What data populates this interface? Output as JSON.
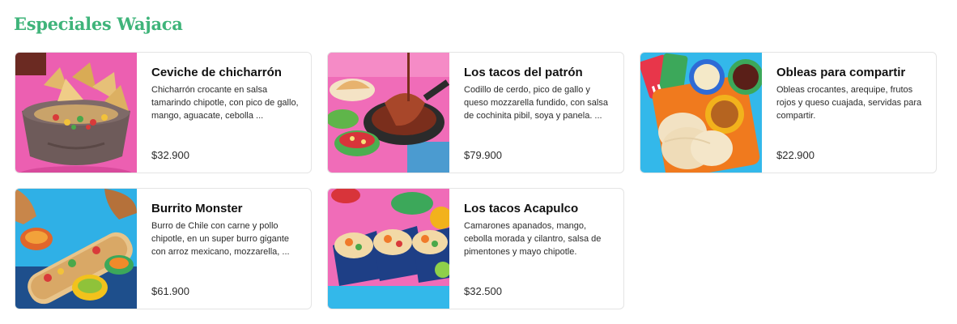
{
  "section": {
    "title": "Especiales Wajaca"
  },
  "items": [
    {
      "name": "Ceviche de chicharrón",
      "description": "Chicharrón crocante en salsa tamarindo chipotle, con pico de gallo, mango, aguacate, cebolla ...",
      "price": "$32.900",
      "image_icon": "ceviche-bowl-icon"
    },
    {
      "name": "Los tacos del patrón",
      "description": "Codillo de cerdo, pico de gallo y queso mozzarella fundido, con salsa de cochinita pibil, soya y panela. ...",
      "price": "$79.900",
      "image_icon": "tacos-skillet-icon"
    },
    {
      "name": "Obleas para compartir",
      "description": "Obleas crocantes, arequipe, frutos rojos y queso cuajada, servidas para compartir.",
      "price": "$22.900",
      "image_icon": "obleas-tray-icon"
    },
    {
      "name": "Burrito Monster",
      "description": "Burro de Chile con carne y pollo chipotle, en un super burro gigante con arroz mexicano, mozzarella, ...",
      "price": "$61.900",
      "image_icon": "burrito-icon"
    },
    {
      "name": "Los tacos Acapulco",
      "description": "Camarones apanados, mango, cebolla morada y cilantro,  salsa de pimentones y mayo chipotle.",
      "price": "$32.500",
      "image_icon": "shrimp-tacos-icon"
    }
  ],
  "colors": {
    "title_green": "#3fb47a",
    "card_border": "#e4e4e4",
    "photo_pink": "#f25fb3",
    "photo_blue": "#2fb6e8"
  }
}
